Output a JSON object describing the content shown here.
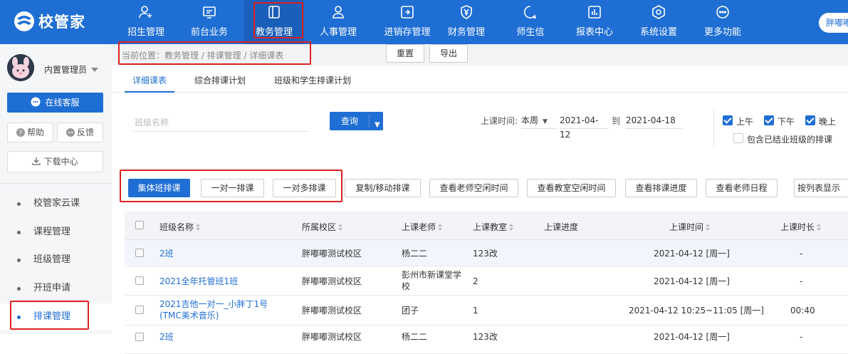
{
  "app": {
    "name": "校管家"
  },
  "nav": [
    {
      "label": "招生管理",
      "icon": "add-user-icon"
    },
    {
      "label": "前台业务",
      "icon": "monitor-icon"
    },
    {
      "label": "教务管理",
      "icon": "book-icon"
    },
    {
      "label": "人事管理",
      "icon": "person-icon"
    },
    {
      "label": "进销存管理",
      "icon": "inventory-icon"
    },
    {
      "label": "财务管理",
      "icon": "yen-shield-icon"
    },
    {
      "label": "师生信",
      "icon": "chat-icon"
    },
    {
      "label": "报表中心",
      "icon": "chart-icon"
    },
    {
      "label": "系统设置",
      "icon": "settings-icon"
    },
    {
      "label": "更多功能",
      "icon": "more-icon"
    }
  ],
  "user": {
    "pill": "胖嘟嘟",
    "name": "内置管理员"
  },
  "sidebar": {
    "service": "在线客服",
    "help": "帮助",
    "feedback": "反馈",
    "download": "下载中心",
    "items": [
      {
        "label": "校管家云课"
      },
      {
        "label": "课程管理"
      },
      {
        "label": "班级管理"
      },
      {
        "label": "开班申请"
      },
      {
        "label": "排课管理"
      }
    ]
  },
  "breadcrumb": "当前位置：教务管理 / 排课管理 / 详细课表",
  "tabs": [
    "详细课表",
    "综合排课计划",
    "班级和学生排课计划"
  ],
  "filters": {
    "class_placeholder": "班级名称",
    "query": "查询",
    "reset": "重置",
    "export": "导出",
    "time_label": "上课时间:",
    "week": "本周",
    "date_from": "2021-04-12",
    "to": "到",
    "date_to": "2021-04-18",
    "am": "上午",
    "pm": "下午",
    "night": "晚上",
    "include_closed": "包含已结业班级的排课"
  },
  "actions": [
    "集体班排课",
    "一对一排课",
    "一对多排课",
    "复制/移动排课",
    "查看老师空闲时间",
    "查看教室空闲时间",
    "查看排课进度",
    "查看老师日程"
  ],
  "view_mode": "按列表显示",
  "table": {
    "headers": [
      "班级名称",
      "所属校区",
      "上课老师",
      "上课教室",
      "上课进度",
      "上课时间",
      "上课时长"
    ],
    "rows": [
      {
        "name": "2班",
        "campus": "胖嘟嘟测试校区",
        "teacher": "杨二二",
        "room": "123改",
        "progress": "",
        "time": "2021-04-12 [周一]",
        "duration": "-"
      },
      {
        "name": "2021全年托管班1班",
        "campus": "胖嘟嘟测试校区",
        "teacher": "彭州市新课堂学校",
        "room": "2",
        "progress": "",
        "time": "2021-04-12 [周一]",
        "duration": "-"
      },
      {
        "name": "2021吉他一对一_小胖丁1号 (TMC美术音乐)",
        "campus": "胖嘟嘟测试校区",
        "teacher": "团子",
        "room": "1",
        "progress": "",
        "time": "2021-04-12 10:25~11:05 [周一]",
        "duration": "00:40"
      },
      {
        "name": "2班",
        "campus": "胖嘟嘟测试校区",
        "teacher": "杨二二",
        "room": "123改",
        "progress": "",
        "time": "2021-04-12 [周一]",
        "duration": "-"
      }
    ]
  },
  "colors": {
    "primary": "#1f6ed4",
    "highlight": "#e02020"
  }
}
